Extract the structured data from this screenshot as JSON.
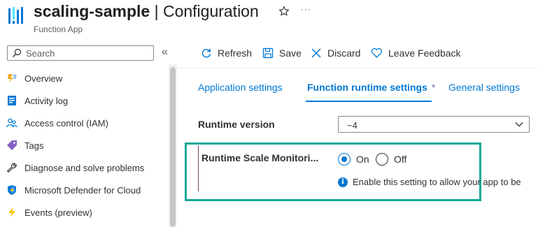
{
  "header": {
    "title_name": "scaling-sample",
    "title_separator": "|",
    "title_page": "Configuration",
    "subtitle": "Function App",
    "favorite_icon": "star-outline-icon",
    "more_icon": "ellipsis-icon",
    "more_glyph": "···"
  },
  "search": {
    "placeholder": "Search",
    "value": ""
  },
  "collapse_glyph": "«",
  "sidebar": {
    "items": [
      {
        "label": "Overview",
        "icon": "lightning-icon"
      },
      {
        "label": "Activity log",
        "icon": "activity-log-icon"
      },
      {
        "label": "Access control (IAM)",
        "icon": "people-icon"
      },
      {
        "label": "Tags",
        "icon": "tag-icon"
      },
      {
        "label": "Diagnose and solve problems",
        "icon": "wrench-icon"
      },
      {
        "label": "Microsoft Defender for Cloud",
        "icon": "shield-icon"
      },
      {
        "label": "Events (preview)",
        "icon": "lightning-bolt-icon"
      }
    ]
  },
  "toolbar": {
    "refresh": "Refresh",
    "save": "Save",
    "discard": "Discard",
    "feedback": "Leave Feedback"
  },
  "tabs": [
    {
      "label": "Application settings",
      "active": false
    },
    {
      "label": "Function runtime settings",
      "active": true,
      "asterisk": "*"
    },
    {
      "label": "General settings",
      "active": false
    }
  ],
  "runtime_version": {
    "label": "Runtime version",
    "value": "~4"
  },
  "scale_monitoring": {
    "label": "Runtime Scale Monitori...",
    "options": [
      "On",
      "Off"
    ],
    "selected": "On",
    "info": "Enable this setting to allow your app to be"
  },
  "colors": {
    "accent": "#0078d4",
    "highlight": "#13a999",
    "unsaved_marker": "#8764b8"
  }
}
